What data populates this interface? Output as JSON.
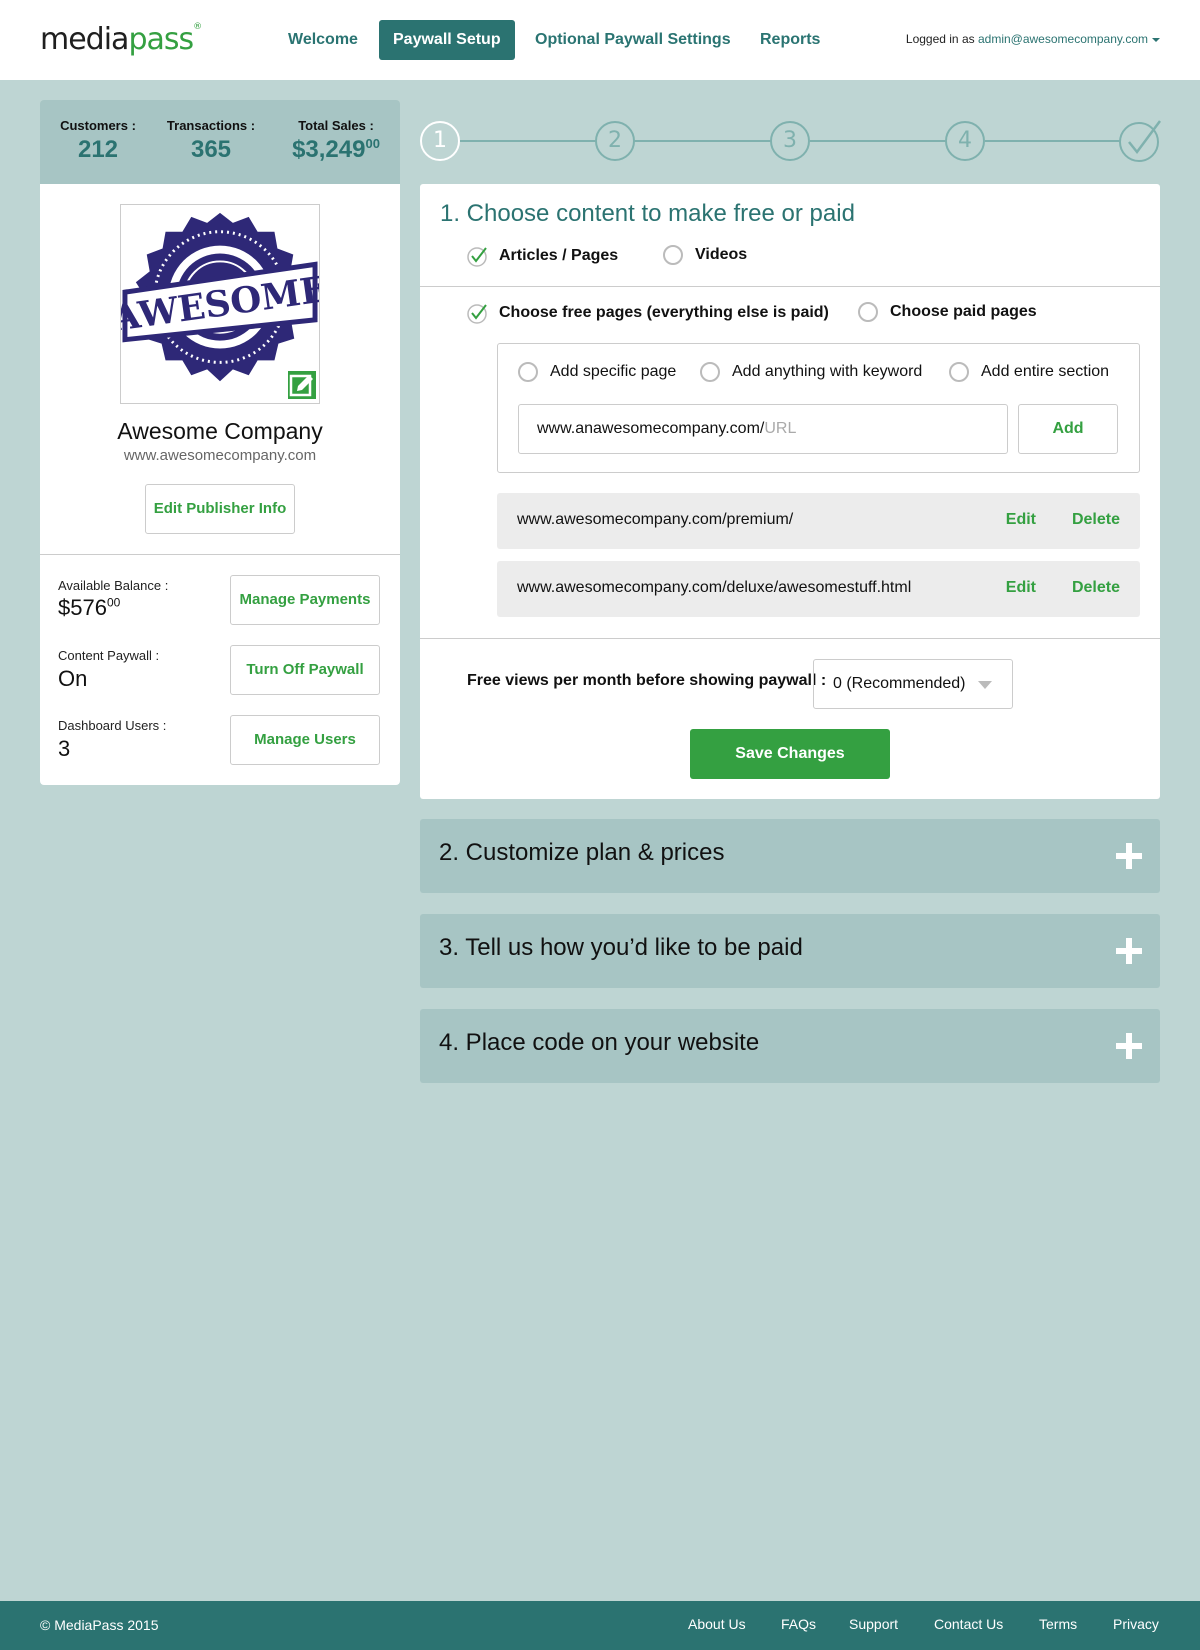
{
  "header": {
    "logo_part1": "media",
    "logo_part2": "pass",
    "logo_tm": "®",
    "nav": [
      "Welcome",
      "Paywall Setup",
      "Optional Paywall Settings",
      "Reports"
    ],
    "login_prefix": "Logged in as",
    "login_email": "admin@awesomecompany.com"
  },
  "stats": {
    "customers_label": "Customers :",
    "customers": "212",
    "transactions_label": "Transactions :",
    "transactions": "365",
    "sales_label": "Total Sales :",
    "sales_main": "$3,249",
    "sales_cents": "00"
  },
  "publisher": {
    "logo_text": "AWESOME",
    "name": "Awesome Company",
    "url": "www.awesomecompany.com",
    "edit_label": "Edit Publisher Info",
    "balance_label": "Available Balance :",
    "balance_main": "$576",
    "balance_cents": "00",
    "manage_payments": "Manage Payments",
    "paywall_label": "Content Paywall :",
    "paywall_value": "On",
    "turn_off": "Turn Off Paywall",
    "users_label": "Dashboard Users :",
    "users_value": "3",
    "manage_users": "Manage Users"
  },
  "steps": [
    "1",
    "2",
    "3",
    "4"
  ],
  "section1": {
    "title": "1. Choose content to make free or paid",
    "opt_articles": "Articles / Pages",
    "opt_videos": "Videos",
    "opt_free": "Choose free pages (everything else is paid)",
    "opt_paid": "Choose paid pages",
    "add_specific": "Add specific page",
    "add_keyword": "Add anything with keyword",
    "add_section": "Add entire section",
    "url_value": "www.anawesomecompany.com/",
    "url_placeholder": "URL",
    "add_button": "Add",
    "rows": [
      {
        "url": "www.awesomecompany.com/premium/",
        "edit": "Edit",
        "delete": "Delete"
      },
      {
        "url": "www.awesomecompany.com/deluxe/awesomestuff.html",
        "edit": "Edit",
        "delete": "Delete"
      }
    ],
    "free_views_label": "Free views per month before showing paywall :",
    "free_views_value": "0 (Recommended)",
    "save_label": "Save Changes"
  },
  "sections": [
    "2. Customize plan & prices",
    "3. Tell us how you’d like to be paid",
    "4. Place code on your website"
  ],
  "footer": {
    "copyright": "© MediaPass 2015",
    "links": [
      "About Us",
      "FAQs",
      "Support",
      "Contact Us",
      "Terms",
      "Privacy"
    ]
  },
  "colors": {
    "teal": "#2b7371",
    "green": "#34a041",
    "panel_bg": "#a7c5c4",
    "page_bg": "#bed5d3"
  }
}
